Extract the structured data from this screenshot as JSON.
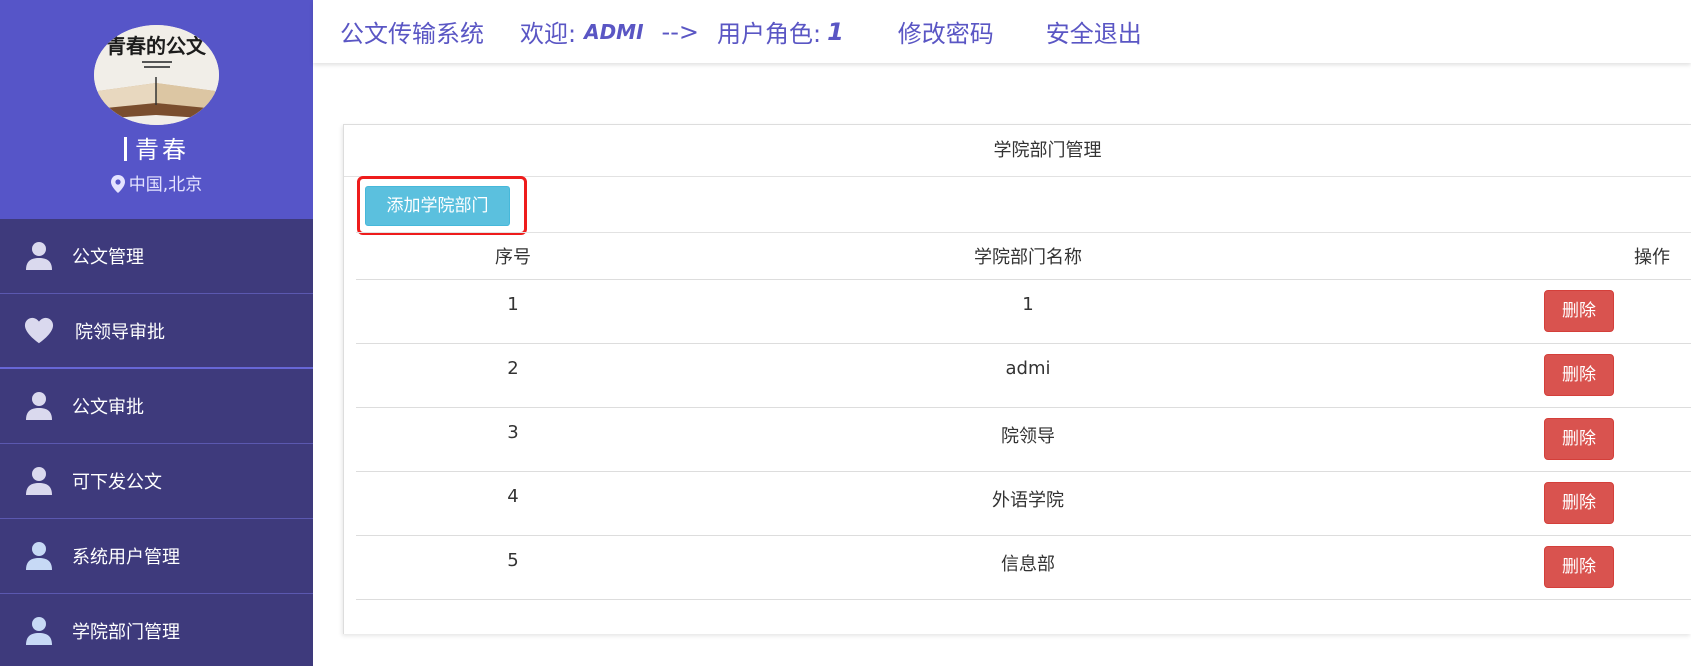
{
  "header": {
    "system_title": "公文传输系统",
    "welcome_label": "欢迎:",
    "username": "ADMI",
    "arrow": "-->",
    "role_label": "用户角色:",
    "role_value": "1",
    "change_password": "修改密码",
    "logout": "安全退出"
  },
  "profile": {
    "avatar_text": "青春的公文",
    "name": "青春",
    "location": "中国,北京"
  },
  "sidebar": {
    "items": [
      {
        "label": "公文管理",
        "icon": "user-icon"
      },
      {
        "label": "院领导审批",
        "icon": "heart-icon"
      },
      {
        "label": "公文审批",
        "icon": "user-icon"
      },
      {
        "label": "可下发公文",
        "icon": "user-icon"
      },
      {
        "label": "系统用户管理",
        "icon": "user-icon"
      },
      {
        "label": "学院部门管理",
        "icon": "user-icon"
      }
    ]
  },
  "panel": {
    "title": "学院部门管理",
    "add_button": "添加学院部门",
    "columns": [
      "序号",
      "学院部门名称",
      "操作"
    ],
    "rows": [
      {
        "index": "1",
        "name": "1",
        "action": "删除"
      },
      {
        "index": "2",
        "name": "admi",
        "action": "删除"
      },
      {
        "index": "3",
        "name": "院领导",
        "action": "删除"
      },
      {
        "index": "4",
        "name": "外语学院",
        "action": "删除"
      },
      {
        "index": "5",
        "name": "信息部",
        "action": "删除"
      }
    ]
  },
  "colors": {
    "sidebar_bg": "#3e3a7c",
    "profile_bg": "#5655c8",
    "header_text": "#5a56c4",
    "add_button": "#5bc0de",
    "delete_button": "#d9534f",
    "highlight_border": "#ee1c1c"
  }
}
